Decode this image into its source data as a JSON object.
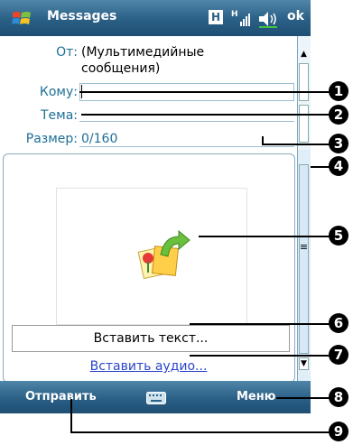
{
  "window": {
    "title": "Messages",
    "ok_label": "ok",
    "h_badge": "H"
  },
  "header": {
    "from_label": "От:",
    "from_value_line1": "(Мультимедийные",
    "from_value_line2": "сообщения)",
    "to_label": "Кому:",
    "subject_label": "Тема:",
    "size_label": "Размер:",
    "size_value": "0/160"
  },
  "body": {
    "insert_text_label": "Вставить текст...",
    "insert_audio_label": "Вставить аудио..."
  },
  "bottombar": {
    "send_label": "Отправить",
    "menu_label": "Меню"
  },
  "callouts": [
    "1",
    "2",
    "3",
    "4",
    "5",
    "6",
    "7",
    "8",
    "9"
  ],
  "icons": {
    "start": "windows-start-icon",
    "network": "network-signal-icon",
    "volume": "volume-muted-icon",
    "keyboard": "keyboard-icon",
    "media": "insert-picture-icon"
  }
}
